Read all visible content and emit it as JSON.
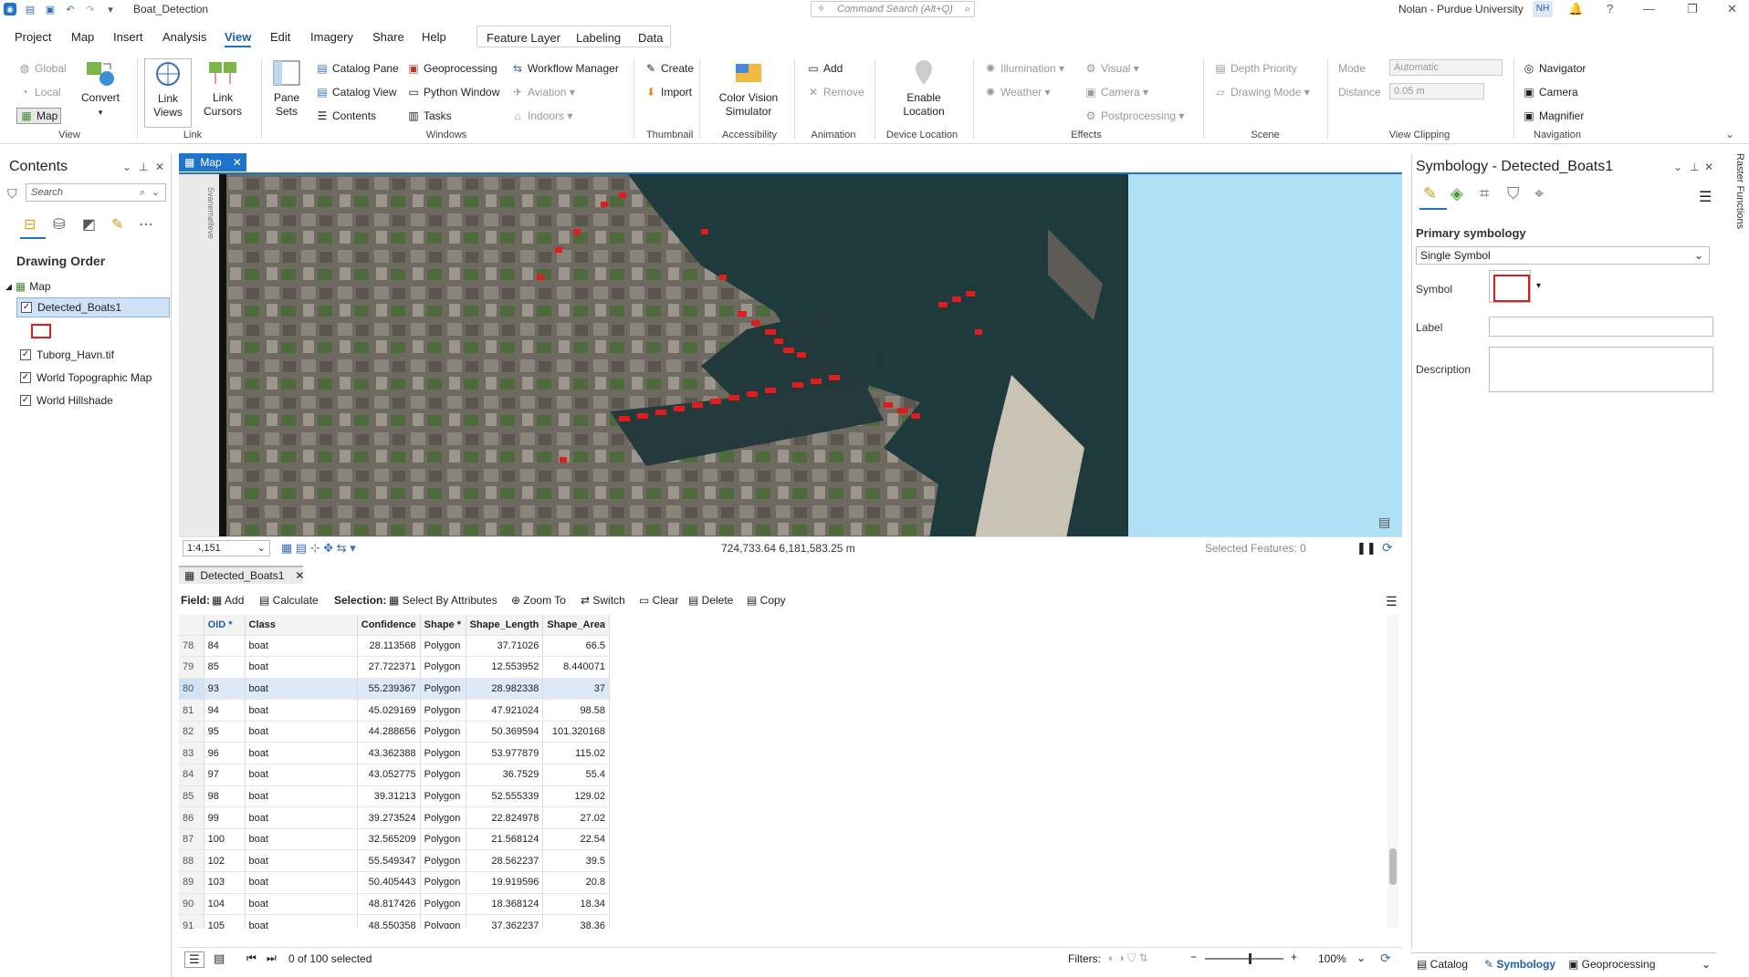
{
  "titlebar": {
    "project_name": "Boat_Detection",
    "command_search_placeholder": "Command Search (Alt+Q)",
    "user": "Nolan - Purdue University",
    "initials": "NH"
  },
  "menu": {
    "tabs": [
      "Project",
      "Map",
      "Insert",
      "Analysis",
      "View",
      "Edit",
      "Imagery",
      "Share",
      "Help"
    ],
    "context_tabs": [
      "Feature Layer",
      "Labeling",
      "Data"
    ]
  },
  "ribbon": {
    "view_group": {
      "global": "Global",
      "local": "Local",
      "map": "Map",
      "convert": "Convert",
      "label": "View"
    },
    "link_group": {
      "link_views": "Link\nViews",
      "link_cursors": "Link\nCursors",
      "label": "Link"
    },
    "windows_group": {
      "pane_sets": "Pane\nSets",
      "catalog_pane": "Catalog Pane",
      "catalog_view": "Catalog View",
      "contents": "Contents",
      "geoprocessing": "Geoprocessing",
      "python_window": "Python Window",
      "tasks": "Tasks",
      "workflow_manager": "Workflow Manager",
      "aviation": "Aviation",
      "indoors": "Indoors",
      "label": "Windows"
    },
    "thumbnail_group": {
      "create": "Create",
      "import": "Import",
      "label": "Thumbnail"
    },
    "accessibility_group": {
      "color_vision": "Color Vision\nSimulator",
      "label": "Accessibility"
    },
    "animation_group": {
      "add": "Add",
      "remove": "Remove",
      "label": "Animation"
    },
    "device_group": {
      "enable_location": "Enable\nLocation",
      "label": "Device Location"
    },
    "effects_group": {
      "illumination": "Illumination",
      "weather": "Weather",
      "visual": "Visual",
      "camera": "Camera",
      "postprocessing": "Postprocessing",
      "label": "Effects"
    },
    "scene_group": {
      "depth_priority": "Depth Priority",
      "drawing_mode": "Drawing Mode",
      "label": "Scene"
    },
    "clipping_group": {
      "mode_label": "Mode",
      "mode_value": "Automatic",
      "distance_label": "Distance",
      "distance_value": "0.05 m",
      "label": "View Clipping"
    },
    "navigation_group": {
      "navigator": "Navigator",
      "camera": "Camera",
      "magnifier": "Magnifier",
      "label": "Navigation"
    }
  },
  "contents": {
    "title": "Contents",
    "search_placeholder": "Search",
    "drawing_order": "Drawing Order",
    "map_name": "Map",
    "layers": [
      "Detected_Boats1",
      "Tuborg_Havn.tif",
      "World Topographic Map",
      "World Hillshade"
    ]
  },
  "map": {
    "tab_label": "Map",
    "street_label": "Svanemølleve",
    "scale": "1:4,151",
    "coordinates": "724,733.64 6,181,583.25 m",
    "selected_features": "Selected Features: 0"
  },
  "attribute_table": {
    "tab_label": "Detected_Boats1",
    "toolbar": {
      "field": "Field:",
      "add": "Add",
      "calculate": "Calculate",
      "selection": "Selection:",
      "select_by_attributes": "Select By Attributes",
      "zoom_to": "Zoom To",
      "switch": "Switch",
      "clear": "Clear",
      "delete": "Delete",
      "copy": "Copy"
    },
    "columns": [
      "",
      "OID *",
      "Class",
      "Confidence",
      "Shape *",
      "Shape_Length",
      "Shape_Area"
    ],
    "rows": [
      [
        "78",
        "84",
        "boat",
        "28.113568",
        "Polygon",
        "37.71026",
        "66.5"
      ],
      [
        "79",
        "85",
        "boat",
        "27.722371",
        "Polygon",
        "12.553952",
        "8.440071"
      ],
      [
        "80",
        "93",
        "boat",
        "55.239367",
        "Polygon",
        "28.982338",
        "37"
      ],
      [
        "81",
        "94",
        "boat",
        "45.029169",
        "Polygon",
        "47.921024",
        "98.58"
      ],
      [
        "82",
        "95",
        "boat",
        "44.288656",
        "Polygon",
        "50.369594",
        "101.320168"
      ],
      [
        "83",
        "96",
        "boat",
        "43.362388",
        "Polygon",
        "53.977879",
        "115.02"
      ],
      [
        "84",
        "97",
        "boat",
        "43.052775",
        "Polygon",
        "36.7529",
        "55.4"
      ],
      [
        "85",
        "98",
        "boat",
        "39.31213",
        "Polygon",
        "52.555339",
        "129.02"
      ],
      [
        "86",
        "99",
        "boat",
        "39.273524",
        "Polygon",
        "22.824978",
        "27.02"
      ],
      [
        "87",
        "100",
        "boat",
        "32.565209",
        "Polygon",
        "21.568124",
        "22.54"
      ],
      [
        "88",
        "102",
        "boat",
        "55.549347",
        "Polygon",
        "28.562237",
        "39.5"
      ],
      [
        "89",
        "103",
        "boat",
        "50.405443",
        "Polygon",
        "19.919596",
        "20.8"
      ],
      [
        "90",
        "104",
        "boat",
        "48.817426",
        "Polygon",
        "18.368124",
        "18.34"
      ],
      [
        "91",
        "105",
        "boat",
        "48.550358",
        "Polygon",
        "37.362237",
        "38.36"
      ]
    ],
    "status": "0 of 100 selected",
    "filters": "Filters:",
    "zoom": "100%"
  },
  "symbology": {
    "title": "Symbology - Detected_Boats1",
    "primary": "Primary symbology",
    "method": "Single Symbol",
    "symbol_label": "Symbol",
    "label_label": "Label",
    "description_label": "Description",
    "symbol_color": "#e01c1c"
  },
  "bottom_tabs": [
    "Catalog",
    "Symbology",
    "Geoprocessing"
  ],
  "side_tab": "Raster Functions"
}
